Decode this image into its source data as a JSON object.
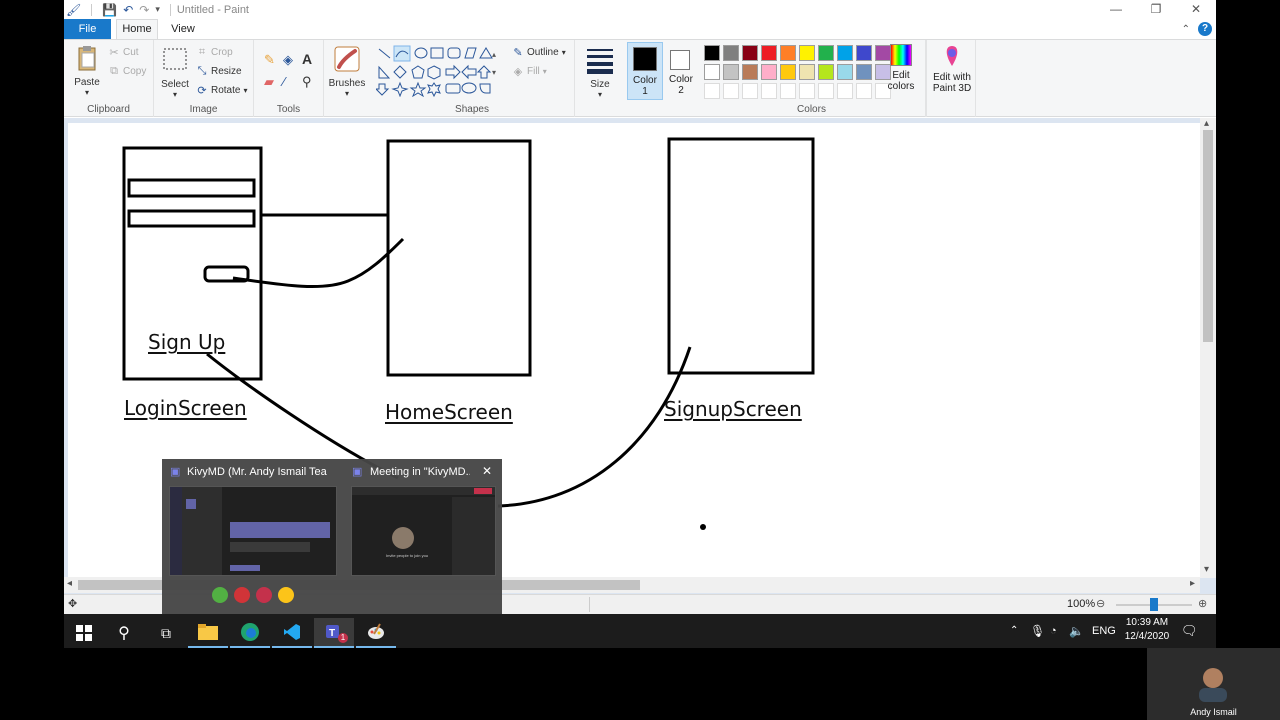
{
  "window": {
    "title": "Untitled - Paint",
    "controls": {
      "minimize": "—",
      "restore": "❐",
      "close": "✕"
    }
  },
  "tabs": {
    "file": "File",
    "home": "Home",
    "view": "View"
  },
  "ribbon": {
    "clipboard": {
      "paste": "Paste",
      "cut": "Cut",
      "copy": "Copy",
      "label": "Clipboard"
    },
    "image": {
      "select": "Select",
      "crop": "Crop",
      "resize": "Resize",
      "rotate": "Rotate",
      "label": "Image"
    },
    "tools": {
      "label": "Tools"
    },
    "brushes": {
      "label": "Brushes"
    },
    "shapes": {
      "outline": "Outline",
      "fill": "Fill",
      "label": "Shapes"
    },
    "size": {
      "label": "Size"
    },
    "color1": {
      "line1": "Color",
      "line2": "1"
    },
    "color2": {
      "line1": "Color",
      "line2": "2"
    },
    "colors": {
      "label": "Colors",
      "row1": [
        "#000000",
        "#7f7f7f",
        "#880015",
        "#ed1c24",
        "#ff7f27",
        "#fff200",
        "#22b14c",
        "#00a2e8",
        "#3f48cc",
        "#a349a4"
      ],
      "row2": [
        "#ffffff",
        "#c3c3c3",
        "#b97a57",
        "#ffaec9",
        "#ffc90e",
        "#efe4b0",
        "#b5e61d",
        "#99d9ea",
        "#7092be",
        "#c8bfe7"
      ]
    },
    "edit_colors": {
      "line1": "Edit",
      "line2": "colors"
    },
    "paint3d": {
      "line1": "Edit with",
      "line2": "Paint 3D"
    }
  },
  "canvas": {
    "labels": {
      "sign_up": "Sign Up",
      "login": "LoginScreen",
      "home": "HomeScreen",
      "signup": "SignupScreen"
    }
  },
  "statusbar": {
    "zoom": "100%"
  },
  "preview": {
    "window1_title": "KivyMD (Mr. Andy Ismail Team'...",
    "window2_title": "Meeting in \"KivyMD...",
    "invite_text": "Invite people to join you"
  },
  "taskbar": {
    "language": "ENG",
    "time": "10:39 AM",
    "date": "12/4/2020",
    "teams_badge": "1"
  },
  "webcam": {
    "name": "Andy Ismail"
  }
}
